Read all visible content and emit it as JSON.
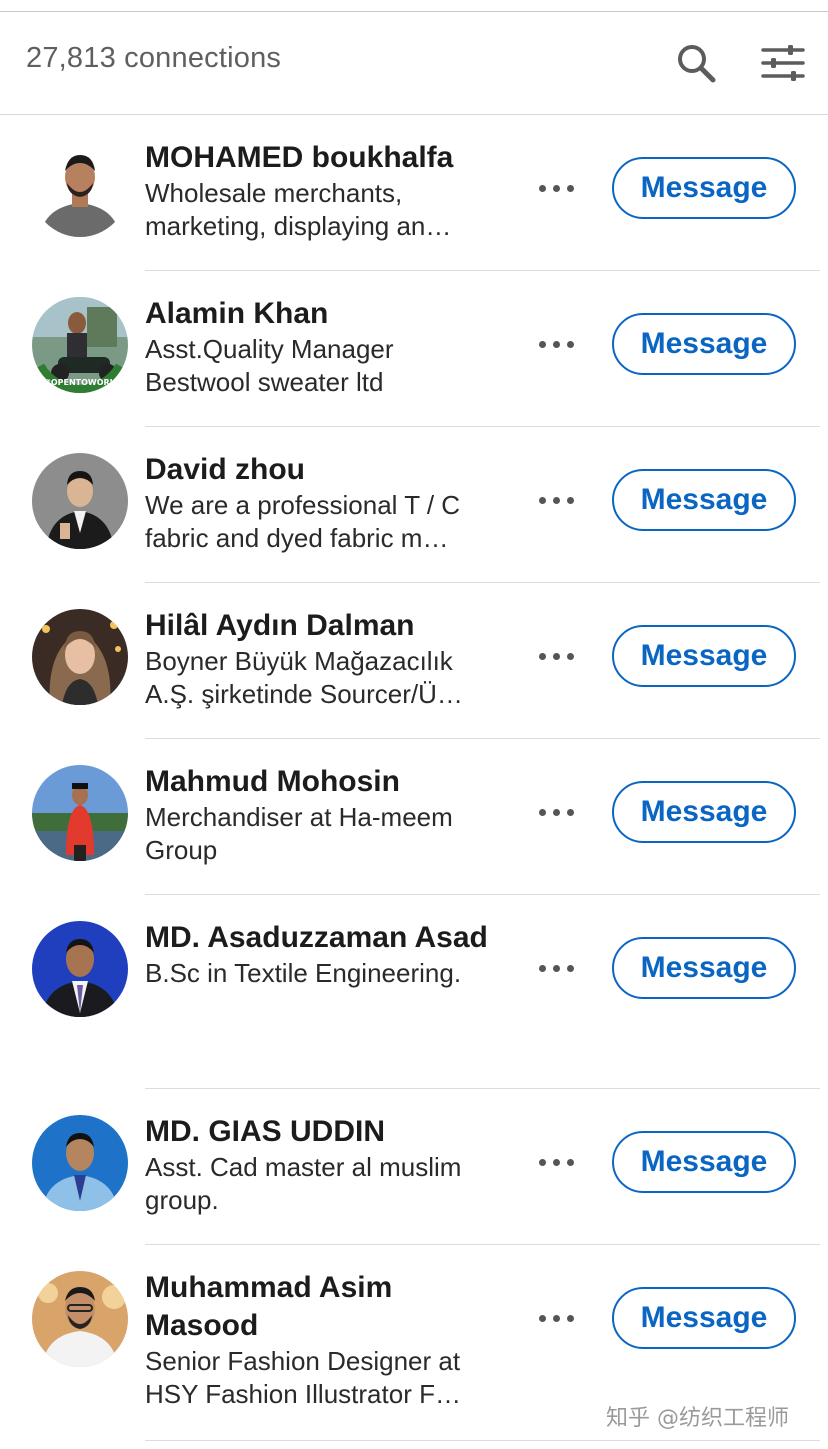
{
  "header": {
    "connections_count": "27,813 connections",
    "search_icon": "search-icon",
    "filter_icon": "sliders-icon"
  },
  "colors": {
    "accent": "#0a66c2",
    "text": "#1c1c1c",
    "muted": "#5f5f5f",
    "divider": "#dcdcdc"
  },
  "connections": [
    {
      "name": "MOHAMED boukhalfa",
      "headline": "Wholesale merchants, marketing, displaying an…",
      "message_label": "Message",
      "more_icon": "ellipsis-icon"
    },
    {
      "name": "Alamin Khan",
      "headline": "Asst.Quality Manager Bestwool sweater ltd",
      "message_label": "Message",
      "more_icon": "ellipsis-icon",
      "badge": "#OPENTOWORK"
    },
    {
      "name": "David zhou",
      "headline": "We are a professional T / C fabric and dyed fabric m…",
      "message_label": "Message",
      "more_icon": "ellipsis-icon"
    },
    {
      "name": "Hilâl Aydın Dalman",
      "headline": "Boyner Büyük Mağazacılık A.Ş. şirketinde Sourcer/Ü…",
      "message_label": "Message",
      "more_icon": "ellipsis-icon"
    },
    {
      "name": "Mahmud Mohosin",
      "headline": "Merchandiser at Ha-meem Group",
      "message_label": "Message",
      "more_icon": "ellipsis-icon"
    },
    {
      "name": "MD. Asaduzzaman Asad",
      "headline": "B.Sc in Textile Engineering.",
      "message_label": "Message",
      "more_icon": "ellipsis-icon"
    },
    {
      "name": "MD. GIAS UDDIN",
      "headline": "Asst. Cad master al muslim group.",
      "message_label": "Message",
      "more_icon": "ellipsis-icon"
    },
    {
      "name": "Muhammad Asim Masood",
      "headline": "Senior Fashion Designer at HSY Fashion Illustrator F…",
      "message_label": "Message",
      "more_icon": "ellipsis-icon"
    }
  ],
  "watermark": "知乎 @纺织工程师"
}
